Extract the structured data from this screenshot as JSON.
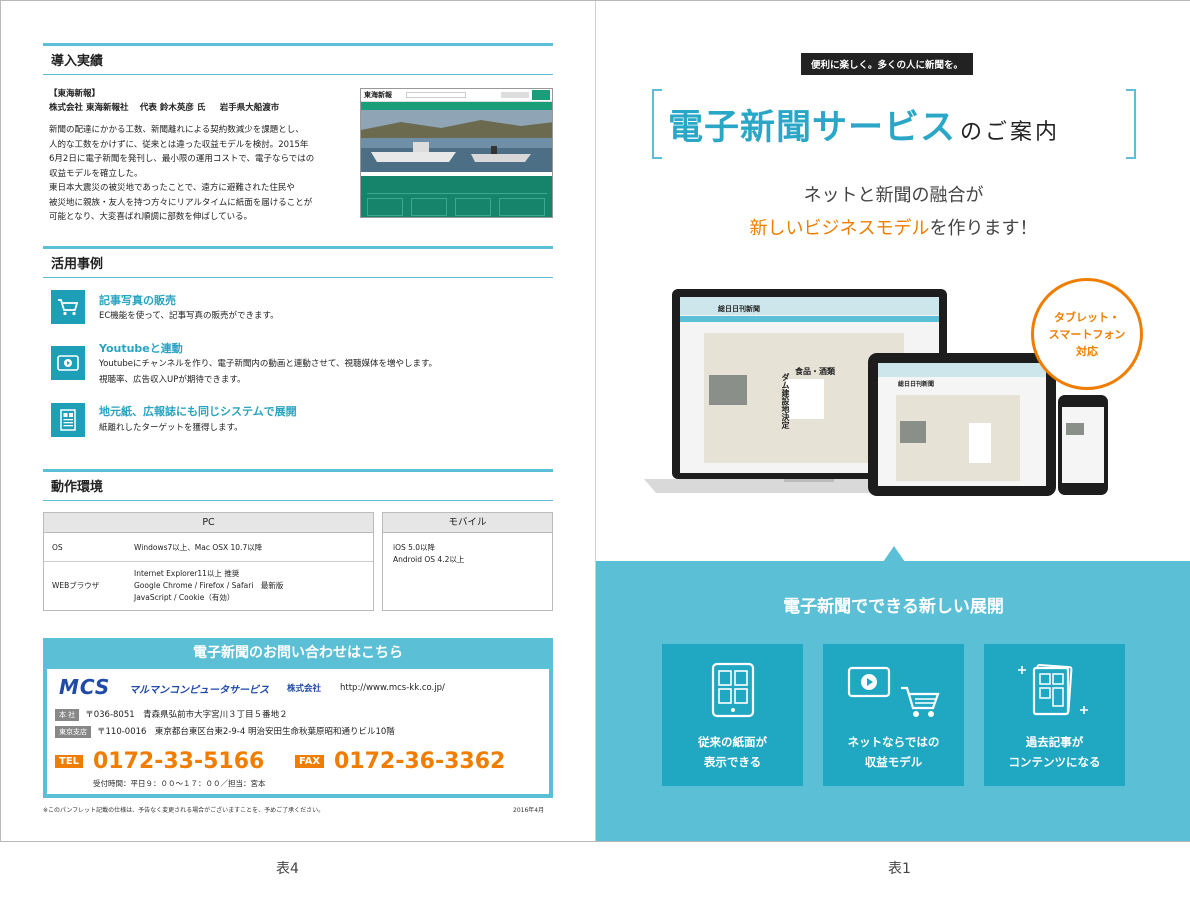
{
  "back": {
    "section1": {
      "title": "導入実績",
      "client_tag": "【東海新報】",
      "client_line": "株式会社 東海新報社　 代表 鈴木英彦 氏 　 岩手県大船渡市",
      "body": [
        "新聞の配達にかかる工数、新聞離れによる契約数減少を課題とし、",
        "人的な工数をかけずに、従来とは違った収益モデルを検討。2015年",
        "6月2日に電子新聞を発刊し、最小限の運用コストで、電子ならではの",
        "収益モデルを確立した。",
        "東日本大震災の被災地であったことで、遠方に避難された住民や",
        "被災地に親族・友人を持つ方々にリアルタイムに紙面を届けることが",
        "可能となり、大変喜ばれ順調に部数を伸ばしている。"
      ],
      "site_logo": "東海新報"
    },
    "section2": {
      "title": "活用事例",
      "items": [
        {
          "title": "記事写真の販売",
          "desc": [
            "EC機能を使って、記事写真の販売ができます。"
          ],
          "icon": "cart-icon"
        },
        {
          "title": "Youtubeと連動",
          "desc": [
            "Youtubeにチャンネルを作り、電子新聞内の動画と連動させて、視聴媒体を増やします。",
            "視聴率、広告収入UPが期待できます。"
          ],
          "icon": "play-icon"
        },
        {
          "title": "地元紙、広報誌にも同じシステムで展開",
          "desc": [
            "紙離れしたターゲットを獲得します。"
          ],
          "icon": "newspaper-icon"
        }
      ]
    },
    "section3": {
      "title": "動作環境",
      "pc_header": "PC",
      "mobile_header": "モバイル",
      "pc_rows": [
        {
          "label": "OS",
          "values": [
            "Windows7以上、Mac OSX 10.7以降"
          ]
        },
        {
          "label": "WEBブラウザ",
          "values": [
            "Internet Explorer11以上 推奨",
            "Google Chrome / Firefox / Safari　最新版",
            "JavaScript / Cookie（有効）"
          ]
        }
      ],
      "mobile_values": [
        "iOS 5.0以降",
        "Android OS 4.2以上"
      ]
    },
    "contact": {
      "header": "電子新聞のお問い合わせはこちら",
      "logo": "MCS",
      "company_script": "マルマンコンピュータサービス",
      "company_suffix": "株式会社",
      "url": "http://www.mcs-kk.co.jp/",
      "hq_badge": "本 社",
      "hq_address": "〒036-8051　青森県弘前市大字宮川３丁目５番地２",
      "tokyo_badge": "東京支店",
      "tokyo_address": "〒110-0016　東京都台東区台東2-9-4 明治安田生命秋葉原昭和通りビル10階",
      "tel_label": "TEL",
      "tel": "0172-33-5166",
      "fax_label": "FAX",
      "fax": "0172-36-3362",
      "hours": "受付時間：平日９：００～１７：００／担当：宮本"
    },
    "footnote": "※このパンフレット記載の仕様は、予告なく変更される場合がございますことを、予めご了承ください。",
    "date": "2016年4月",
    "page_label": "表4"
  },
  "cover": {
    "catchphrase": "便利に楽しく。多くの人に新聞を。",
    "title_main": "電子新聞サービス",
    "title_suffix": "のご案内",
    "subtitle_line1": "ネットと新聞の融合が",
    "subtitle_highlight": "新しいビジネスモデル",
    "subtitle_tail": "を作ります！",
    "badge": [
      "タブレット・",
      "スマートフォン",
      "対応"
    ],
    "device_masthead": "総日日刊新聞",
    "headline_vertical": "ダム建設地決定",
    "headline_box": "食品・酒類",
    "band_title": "電子新聞でできる新しい展開",
    "features": [
      {
        "label": [
          "従来の紙面が",
          "表示できる"
        ],
        "icon": "tablet-icon"
      },
      {
        "label": [
          "ネットならではの",
          "収益モデル"
        ],
        "icon": "video-cart-icon"
      },
      {
        "label": [
          "過去記事が",
          "コンテンツになる"
        ],
        "icon": "archive-icon"
      }
    ],
    "page_label": "表1"
  },
  "colors": {
    "accent": "#5bbfd6",
    "teal": "#1e9fb8",
    "orange": "#f07d00",
    "dark": "#222222"
  }
}
